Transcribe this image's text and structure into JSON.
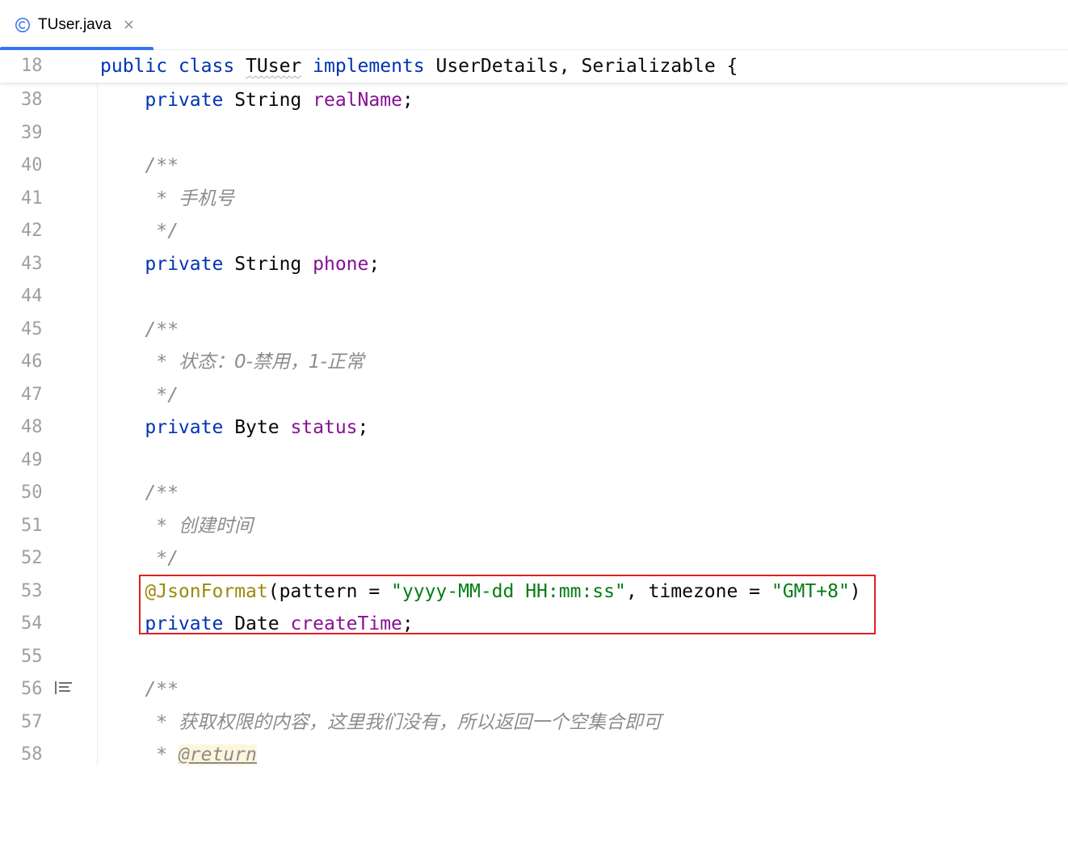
{
  "tab": {
    "title": "TUser.java",
    "close_glyph": "×",
    "icon": "class-icon",
    "accent": "#3574f0"
  },
  "sticky": {
    "line_number": "18",
    "kw1": "public class",
    "class_name": "TUser",
    "kw2": "implements",
    "rest": "UserDetails, Serializable {"
  },
  "lines": {
    "l38": {
      "num": "38",
      "kw": "private",
      "type": "String",
      "field": "realName",
      "end": ";"
    },
    "l39": {
      "num": "39"
    },
    "l40": {
      "num": "40",
      "text": "/**"
    },
    "l41": {
      "num": "41",
      "star": " * ",
      "text": "手机号"
    },
    "l42": {
      "num": "42",
      "text": " */"
    },
    "l43": {
      "num": "43",
      "kw": "private",
      "type": "String",
      "field": "phone",
      "end": ";"
    },
    "l44": {
      "num": "44"
    },
    "l45": {
      "num": "45",
      "text": "/**"
    },
    "l46": {
      "num": "46",
      "star": " * ",
      "text": "状态：0-禁用，1-正常"
    },
    "l47": {
      "num": "47",
      "text": " */"
    },
    "l48": {
      "num": "48",
      "kw": "private",
      "type": "Byte",
      "field": "status",
      "end": ";"
    },
    "l49": {
      "num": "49"
    },
    "l50": {
      "num": "50",
      "text": "/**"
    },
    "l51": {
      "num": "51",
      "star": " * ",
      "text": "创建时间"
    },
    "l52": {
      "num": "52",
      "text": " */"
    },
    "l53": {
      "num": "53",
      "annotation": "@JsonFormat",
      "p1": "(pattern = ",
      "s1": "\"yyyy-MM-dd HH:mm:ss\"",
      "p2": ", timezone = ",
      "s2": "\"GMT+8\"",
      "p3": ")"
    },
    "l54": {
      "num": "54",
      "kw": "private",
      "type": "Date",
      "field": "createTime",
      "end": ";"
    },
    "l55": {
      "num": "55"
    },
    "l56": {
      "num": "56",
      "text": "/**"
    },
    "l57": {
      "num": "57",
      "star": " * ",
      "text": "获取权限的内容，这里我们没有，所以返回一个空集合即可"
    },
    "l58": {
      "num": "58",
      "star": " * ",
      "tag": "@return"
    }
  },
  "gutter": {
    "doc_render_icon": "align-left-icon"
  },
  "colors": {
    "keyword": "#0033b3",
    "field": "#871094",
    "comment": "#8c8c8c",
    "annotation": "#9e880d",
    "string": "#067d17",
    "highlight_box": "#e02020"
  }
}
